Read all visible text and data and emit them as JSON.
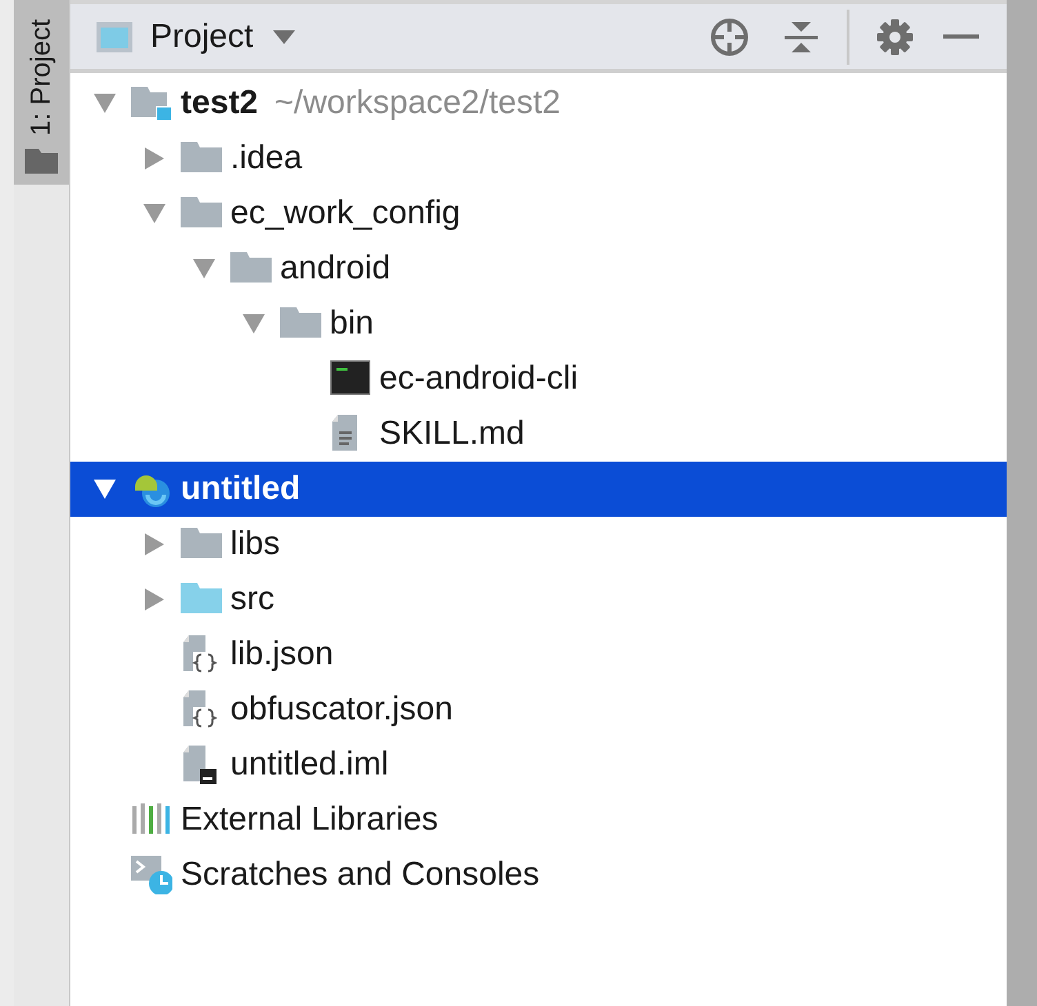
{
  "tool_window_tab": {
    "label": "1: Project",
    "selected": true
  },
  "header": {
    "view_selector": "Project"
  },
  "tree": [
    {
      "kind": "project",
      "label": "test2",
      "path": "~/workspace2/test2",
      "expanded": true,
      "selected": false,
      "children": [
        {
          "kind": "folder",
          "label": ".idea",
          "expanded": false,
          "selected": false
        },
        {
          "kind": "folder",
          "label": "ec_work_config",
          "expanded": true,
          "selected": false,
          "children": [
            {
              "kind": "folder",
              "label": "android",
              "expanded": true,
              "selected": false,
              "children": [
                {
                  "kind": "folder",
                  "label": "bin",
                  "expanded": true,
                  "selected": false,
                  "children": [
                    {
                      "kind": "terminal",
                      "label": "ec-android-cli",
                      "selected": false
                    },
                    {
                      "kind": "text",
                      "label": "SKILL.md",
                      "selected": false
                    }
                  ]
                }
              ]
            }
          ]
        }
      ]
    },
    {
      "kind": "module",
      "label": "untitled",
      "expanded": true,
      "selected": true,
      "children": [
        {
          "kind": "folder",
          "label": "libs",
          "expanded": false,
          "selected": false
        },
        {
          "kind": "source",
          "label": "src",
          "expanded": false,
          "selected": false
        },
        {
          "kind": "json",
          "label": "lib.json",
          "selected": false
        },
        {
          "kind": "json",
          "label": "obfuscator.json",
          "selected": false
        },
        {
          "kind": "iml",
          "label": "untitled.iml",
          "selected": false
        }
      ]
    },
    {
      "kind": "libraries",
      "label": "External Libraries",
      "selected": false
    },
    {
      "kind": "scratches",
      "label": "Scratches and Consoles",
      "selected": false
    }
  ]
}
